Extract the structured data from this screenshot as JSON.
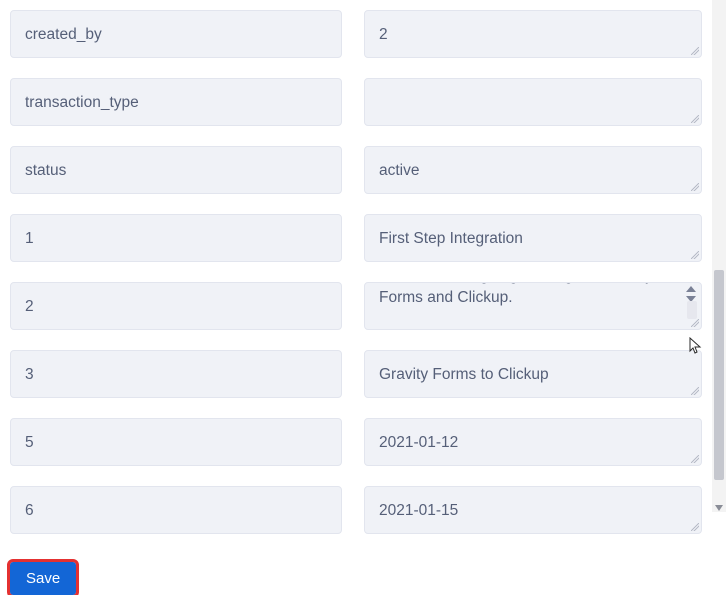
{
  "rows": [
    {
      "key": "created_by",
      "value": "2"
    },
    {
      "key": "transaction_type",
      "value": ""
    },
    {
      "key": "status",
      "value": "active"
    },
    {
      "key": "1",
      "value": "First Step Integration"
    },
    {
      "key": "2",
      "value": "Where we are going to integrate Gravity Forms and Clickup.",
      "tall": true
    },
    {
      "key": "3",
      "value": "Gravity Forms to Clickup"
    },
    {
      "key": "5",
      "value": "2021-01-12"
    },
    {
      "key": "6",
      "value": "2021-01-15"
    }
  ],
  "buttons": {
    "save_label": "Save"
  }
}
